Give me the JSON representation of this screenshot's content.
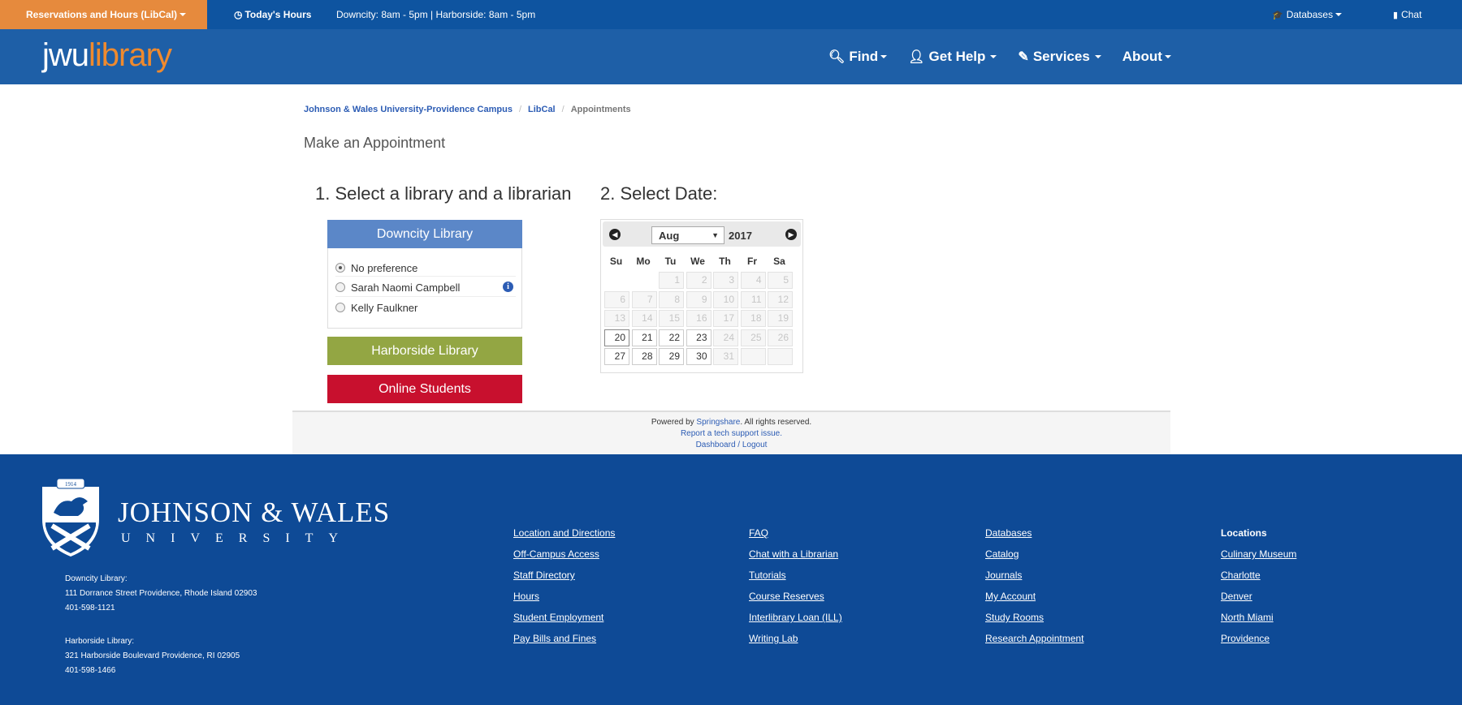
{
  "utility_bar": {
    "reservations_label": "Reservations and Hours (LibCal)",
    "todays_hours_label": "Today's Hours",
    "hours_text": "Downcity: 8am - 5pm | Harborside: 8am - 5pm",
    "databases_label": "Databases",
    "chat_label": "Chat"
  },
  "header": {
    "logo_part1": "jwu",
    "logo_part2": "library",
    "nav": [
      {
        "label": "Find",
        "icon": "search-icon"
      },
      {
        "label": "Get Help",
        "icon": "user-icon"
      },
      {
        "label": "Services",
        "icon": "pencil-icon"
      },
      {
        "label": "About",
        "icon": ""
      }
    ]
  },
  "breadcrumb": {
    "items": [
      "Johnson & Wales University-Providence Campus",
      "LibCal",
      "Appointments"
    ]
  },
  "page_title": "Make an Appointment",
  "step1": {
    "title": "1. Select a library and a librarian",
    "libraries": [
      {
        "label": "Downcity Library",
        "color": "#5b87c8"
      },
      {
        "label": "Harborside Library",
        "color": "#93a643"
      },
      {
        "label": "Online Students",
        "color": "#c8102e"
      }
    ],
    "options": [
      "No preference",
      "Sarah Naomi Campbell",
      "Kelly Faulkner"
    ],
    "selected_option": "No preference"
  },
  "step2": {
    "title": "2. Select Date:",
    "month": "Aug",
    "year": "2017",
    "dow": [
      "Su",
      "Mo",
      "Tu",
      "We",
      "Th",
      "Fr",
      "Sa"
    ],
    "weeks": [
      [
        "",
        "",
        "1",
        "2",
        "3",
        "4",
        "5"
      ],
      [
        "6",
        "7",
        "8",
        "9",
        "10",
        "11",
        "12"
      ],
      [
        "13",
        "14",
        "15",
        "16",
        "17",
        "18",
        "19"
      ],
      [
        "20",
        "21",
        "22",
        "23",
        "24",
        "25",
        "26"
      ],
      [
        "27",
        "28",
        "29",
        "30",
        "31",
        "",
        ""
      ]
    ],
    "available_days": [
      "20",
      "21",
      "22",
      "23",
      "27",
      "28",
      "29",
      "30"
    ],
    "today": "20"
  },
  "springshare_footer": {
    "powered_prefix": "Powered by",
    "springshare": "Springshare",
    "rights": ". All rights reserved.",
    "report": "Report a tech support issue.",
    "dashboard": "Dashboard / Logout"
  },
  "footer": {
    "wordmark": "JOHNSON & WALES",
    "university": "UNIVERSITY",
    "crest_year": "1914",
    "downcity": [
      "Downcity Library:",
      "111 Dorrance Street Providence, Rhode Island 02903",
      "401-598-1121"
    ],
    "harborside": [
      "Harborside Library:",
      "321 Harborside Boulevard Providence, RI 02905",
      "401-598-1466"
    ],
    "col1": [
      "Location and Directions",
      "Off-Campus Access",
      "Staff Directory",
      "Hours",
      "Student Employment",
      "Pay Bills and Fines"
    ],
    "col2": [
      "FAQ",
      "Chat with a Librarian",
      "Tutorials",
      "Course Reserves",
      "Interlibrary Loan (ILL)",
      "Writing Lab"
    ],
    "col3": [
      "Databases",
      "Catalog",
      "Journals",
      "My Account",
      "Study Rooms",
      "Research Appointment"
    ],
    "col4_heading": "Locations",
    "col4": [
      "Culinary Museum",
      "Charlotte",
      "Denver",
      "North Miami",
      "Providence"
    ]
  }
}
